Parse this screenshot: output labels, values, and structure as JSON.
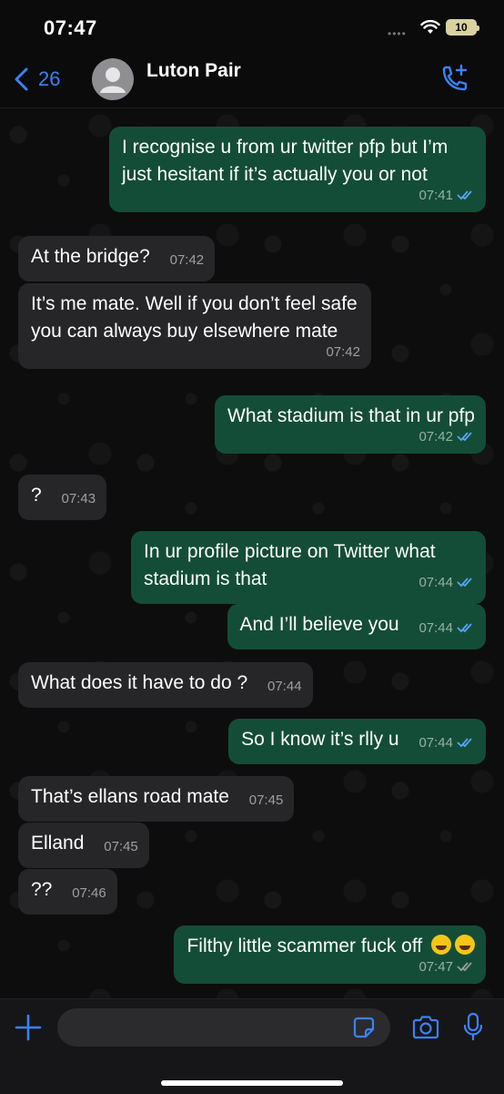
{
  "status_bar": {
    "time": "07:47",
    "signal": "••••",
    "battery": "10"
  },
  "header": {
    "back_count": "26",
    "contact_name": "Luton Pair"
  },
  "messages": [
    {
      "side": "out",
      "text": "I recognise u from ur twitter pfp but I’m just hesitant if it’s actually you or not",
      "time": "07:41",
      "status": "read"
    },
    {
      "side": "in",
      "text": "At the bridge?",
      "time": "07:42"
    },
    {
      "side": "in",
      "text": "It’s me mate. Well if you don’t feel safe you can always buy elsewhere mate",
      "time": "07:42"
    },
    {
      "side": "out",
      "text": "What stadium is that in ur pfp",
      "time": "07:42",
      "status": "read"
    },
    {
      "side": "in",
      "text": "?",
      "time": "07:43"
    },
    {
      "side": "out",
      "text": "In ur profile picture on Twitter what stadium is that",
      "time": "07:44",
      "status": "read"
    },
    {
      "side": "out",
      "text": "And I’ll believe you",
      "time": "07:44",
      "status": "read"
    },
    {
      "side": "in",
      "text": "What does it have to do ?",
      "time": "07:44"
    },
    {
      "side": "out",
      "text": "So I know it’s rlly u",
      "time": "07:44",
      "status": "read"
    },
    {
      "side": "in",
      "text": "That’s ellans road mate",
      "time": "07:45"
    },
    {
      "side": "in",
      "text": "Elland",
      "time": "07:45"
    },
    {
      "side": "in",
      "text": "??",
      "time": "07:46"
    },
    {
      "side": "out",
      "text": "Filthy little scammer fuck off",
      "emoji": [
        "face-with-tears-of-joy",
        "face-with-tears-of-joy"
      ],
      "time": "07:47",
      "status": "delivered"
    }
  ],
  "colors": {
    "outgoing_bubble": "#144d37",
    "incoming_bubble": "#262628",
    "accent": "#3b82f6",
    "read_ticks": "#53a6f7",
    "delivered_ticks": "#9a9a9a"
  },
  "input": {
    "placeholder": ""
  }
}
